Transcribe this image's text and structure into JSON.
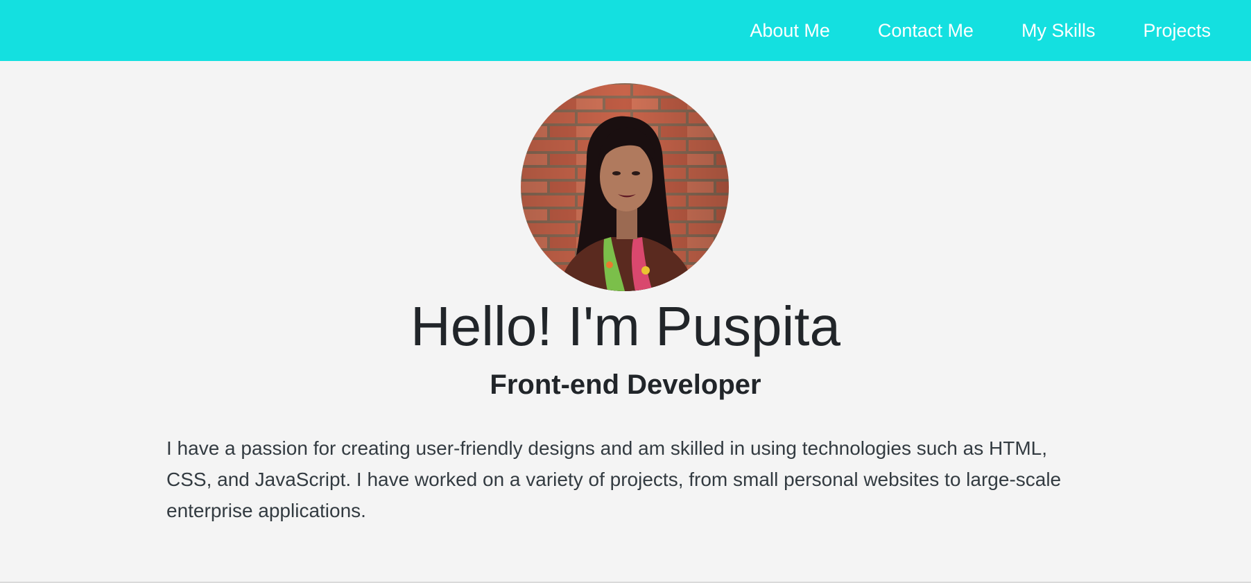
{
  "nav": {
    "items": [
      {
        "label": "About Me"
      },
      {
        "label": "Contact Me"
      },
      {
        "label": "My Skills"
      },
      {
        "label": "Projects"
      }
    ]
  },
  "hero": {
    "greeting": "Hello! I'm Puspita",
    "role": "Front-end Developer",
    "bio": "I have a passion for creating user-friendly designs and am skilled in using technologies such as HTML, CSS, and JavaScript. I have worked on a variety of projects, from small personal websites to large-scale enterprise applications."
  },
  "colors": {
    "navbar": "#14e0e0",
    "background": "#f4f4f4",
    "text": "#212529"
  }
}
